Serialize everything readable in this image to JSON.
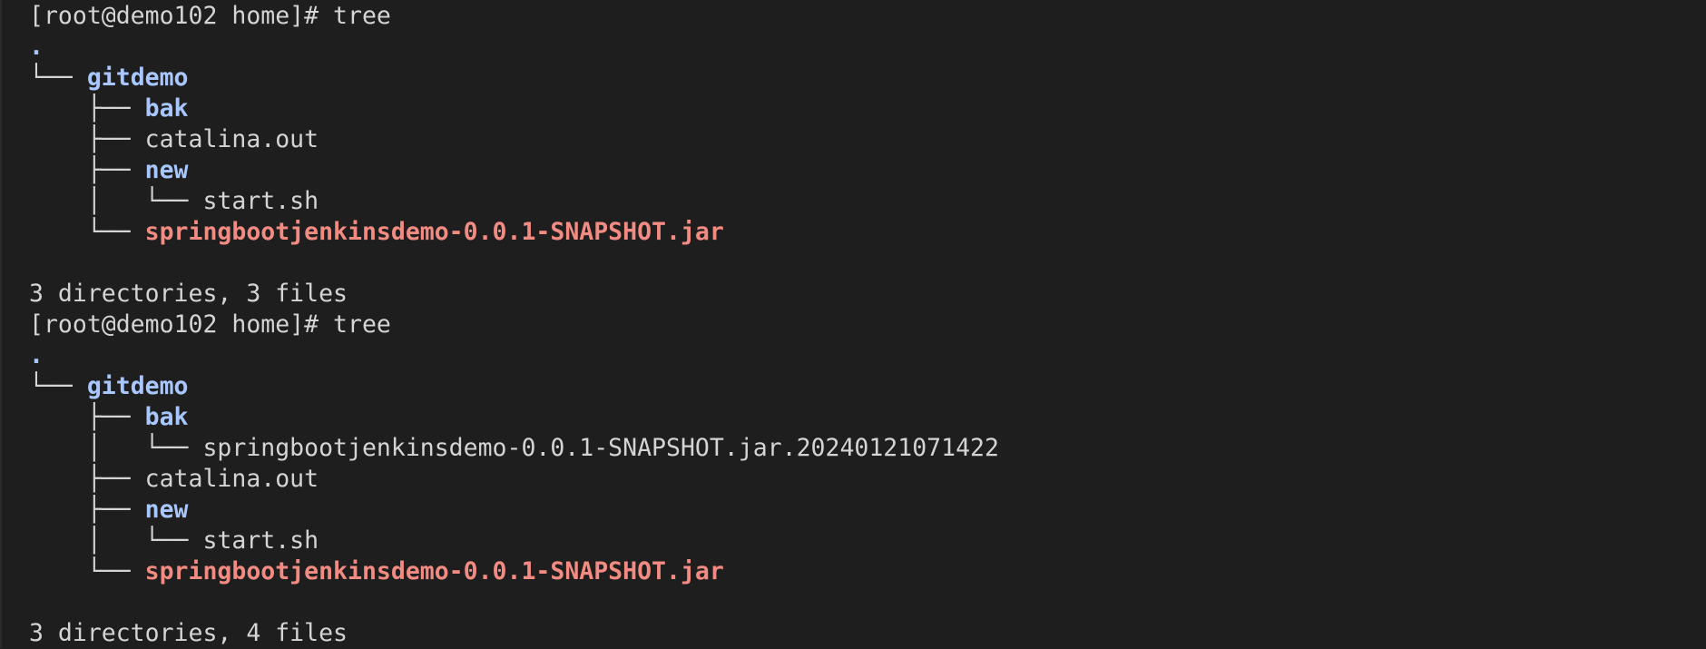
{
  "colors": {
    "background": "#1e1e1e",
    "text": "#d4d4d4",
    "directory": "#a9c7ff",
    "executable": "#f28b82"
  },
  "terminal": {
    "lines": [
      {
        "kind": "prompt",
        "segments": [
          {
            "text": "[root@demo102 home]# tree",
            "style": "plain"
          }
        ]
      },
      {
        "kind": "output",
        "segments": [
          {
            "text": ".",
            "style": "dot"
          }
        ]
      },
      {
        "kind": "output",
        "segments": [
          {
            "text": "└── ",
            "style": "plain"
          },
          {
            "text": "gitdemo",
            "style": "dir"
          }
        ]
      },
      {
        "kind": "output",
        "segments": [
          {
            "text": "    ├── ",
            "style": "plain"
          },
          {
            "text": "bak",
            "style": "dir"
          }
        ]
      },
      {
        "kind": "output",
        "segments": [
          {
            "text": "    ├── ",
            "style": "plain"
          },
          {
            "text": "catalina.out",
            "style": "plain"
          }
        ]
      },
      {
        "kind": "output",
        "segments": [
          {
            "text": "    ├── ",
            "style": "plain"
          },
          {
            "text": "new",
            "style": "dir"
          }
        ]
      },
      {
        "kind": "output",
        "segments": [
          {
            "text": "    │   └── ",
            "style": "plain"
          },
          {
            "text": "start.sh",
            "style": "plain"
          }
        ]
      },
      {
        "kind": "output",
        "segments": [
          {
            "text": "    └── ",
            "style": "plain"
          },
          {
            "text": "springbootjenkinsdemo-0.0.1-SNAPSHOT.jar",
            "style": "exec"
          }
        ]
      },
      {
        "kind": "blank",
        "segments": [
          {
            "text": "",
            "style": "plain"
          }
        ]
      },
      {
        "kind": "output",
        "segments": [
          {
            "text": "3 directories, 3 files",
            "style": "plain"
          }
        ]
      },
      {
        "kind": "prompt",
        "segments": [
          {
            "text": "[root@demo102 home]# tree",
            "style": "plain"
          }
        ]
      },
      {
        "kind": "output",
        "segments": [
          {
            "text": ".",
            "style": "dot"
          }
        ]
      },
      {
        "kind": "output",
        "segments": [
          {
            "text": "└── ",
            "style": "plain"
          },
          {
            "text": "gitdemo",
            "style": "dir"
          }
        ]
      },
      {
        "kind": "output",
        "segments": [
          {
            "text": "    ├── ",
            "style": "plain"
          },
          {
            "text": "bak",
            "style": "dir"
          }
        ]
      },
      {
        "kind": "output",
        "segments": [
          {
            "text": "    │   └── ",
            "style": "plain"
          },
          {
            "text": "springbootjenkinsdemo-0.0.1-SNAPSHOT.jar.20240121071422",
            "style": "plain"
          }
        ]
      },
      {
        "kind": "output",
        "segments": [
          {
            "text": "    ├── ",
            "style": "plain"
          },
          {
            "text": "catalina.out",
            "style": "plain"
          }
        ]
      },
      {
        "kind": "output",
        "segments": [
          {
            "text": "    ├── ",
            "style": "plain"
          },
          {
            "text": "new",
            "style": "dir"
          }
        ]
      },
      {
        "kind": "output",
        "segments": [
          {
            "text": "    │   └── ",
            "style": "plain"
          },
          {
            "text": "start.sh",
            "style": "plain"
          }
        ]
      },
      {
        "kind": "output",
        "segments": [
          {
            "text": "    └── ",
            "style": "plain"
          },
          {
            "text": "springbootjenkinsdemo-0.0.1-SNAPSHOT.jar",
            "style": "exec"
          }
        ]
      },
      {
        "kind": "blank",
        "segments": [
          {
            "text": "",
            "style": "plain"
          }
        ]
      },
      {
        "kind": "output",
        "segments": [
          {
            "text": "3 directories, 4 files",
            "style": "plain"
          }
        ]
      }
    ]
  }
}
